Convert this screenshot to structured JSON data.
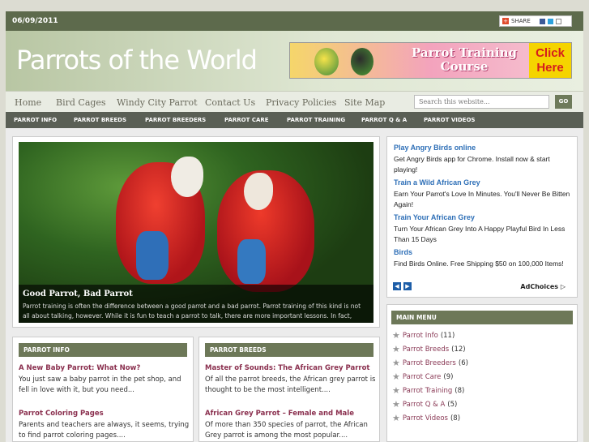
{
  "topbar": {
    "date": "06/09/2011",
    "share_label": "SHARE"
  },
  "header": {
    "site_title": "Parrots of the World",
    "banner_title": "Parrot Training Course",
    "banner_click": "Click Here"
  },
  "nav": {
    "items": [
      "Home",
      "Bird Cages",
      "Windy City Parrot",
      "Contact Us",
      "Privacy Policies",
      "Site Map"
    ],
    "search_placeholder": "Search this website...",
    "go_label": "GO"
  },
  "categories": [
    "PARROT INFO",
    "PARROT BREEDS",
    "PARROT BREEDERS",
    "PARROT CARE",
    "PARROT TRAINING",
    "PARROT Q & A",
    "PARROT VIDEOS"
  ],
  "slider": {
    "caption_title": "Good Parrot, Bad Parrot",
    "caption_text": "Parrot training is often the difference between a good parrot and a bad parrot. Parrot training of this kind is not all about talking, however. While it is fun to teach a parrot to talk, there are more important lessons. In fact, unless your parrot"
  },
  "ads": {
    "items": [
      {
        "title": "Play Angry Birds online",
        "body": "Get Angry Birds app for Chrome. Install now & start playing!"
      },
      {
        "title": "Train a Wild African Grey",
        "body": "Earn Your Parrot's Love In Minutes. You'll Never Be Bitten Again!"
      },
      {
        "title": "Train Your African Grey",
        "body": "Turn Your African Grey Into A Happy Playful Bird In Less Than 15 Days"
      },
      {
        "title": "Birds",
        "body": "Find Birds Online. Free Shipping $50 on 100,000 Items!"
      }
    ],
    "adchoices": "AdChoices ▷"
  },
  "main_menu": {
    "title": "MAIN MENU",
    "items": [
      {
        "label": "Parrot Info",
        "count": "(11)"
      },
      {
        "label": "Parrot Breeds",
        "count": "(12)"
      },
      {
        "label": "Parrot Breeders",
        "count": "(6)"
      },
      {
        "label": "Parrot Care",
        "count": "(9)"
      },
      {
        "label": "Parrot Training",
        "count": "(8)"
      },
      {
        "label": "Parrot Q & A",
        "count": "(5)"
      },
      {
        "label": "Parrot Videos",
        "count": "(8)"
      }
    ]
  },
  "col_info": {
    "title": "PARROT INFO",
    "posts": [
      {
        "title": "A New Baby Parrot: What Now?",
        "body": "You just saw a baby parrot in the pet shop, and fell in love with it, but you need..."
      },
      {
        "title": "Parrot Coloring Pages",
        "body": "Parents and teachers are always, it seems, trying to find parrot coloring pages...."
      }
    ]
  },
  "col_breeds": {
    "title": "PARROT BREEDS",
    "posts": [
      {
        "title": "Master of Sounds: The African Grey Parrot",
        "body": "Of all the parrot breeds, the African grey parrot is thought to be the most intelligent...."
      },
      {
        "title": "African Grey Parrot – Female and Male",
        "body": "Of more than 350 species of parrot, the African Grey parrot is among the most popular...."
      }
    ]
  },
  "colors": {
    "accent": "#6d7858",
    "nav_dark": "#5a5f55",
    "link": "#2e6fb7",
    "post_title": "#8a2f4e"
  }
}
